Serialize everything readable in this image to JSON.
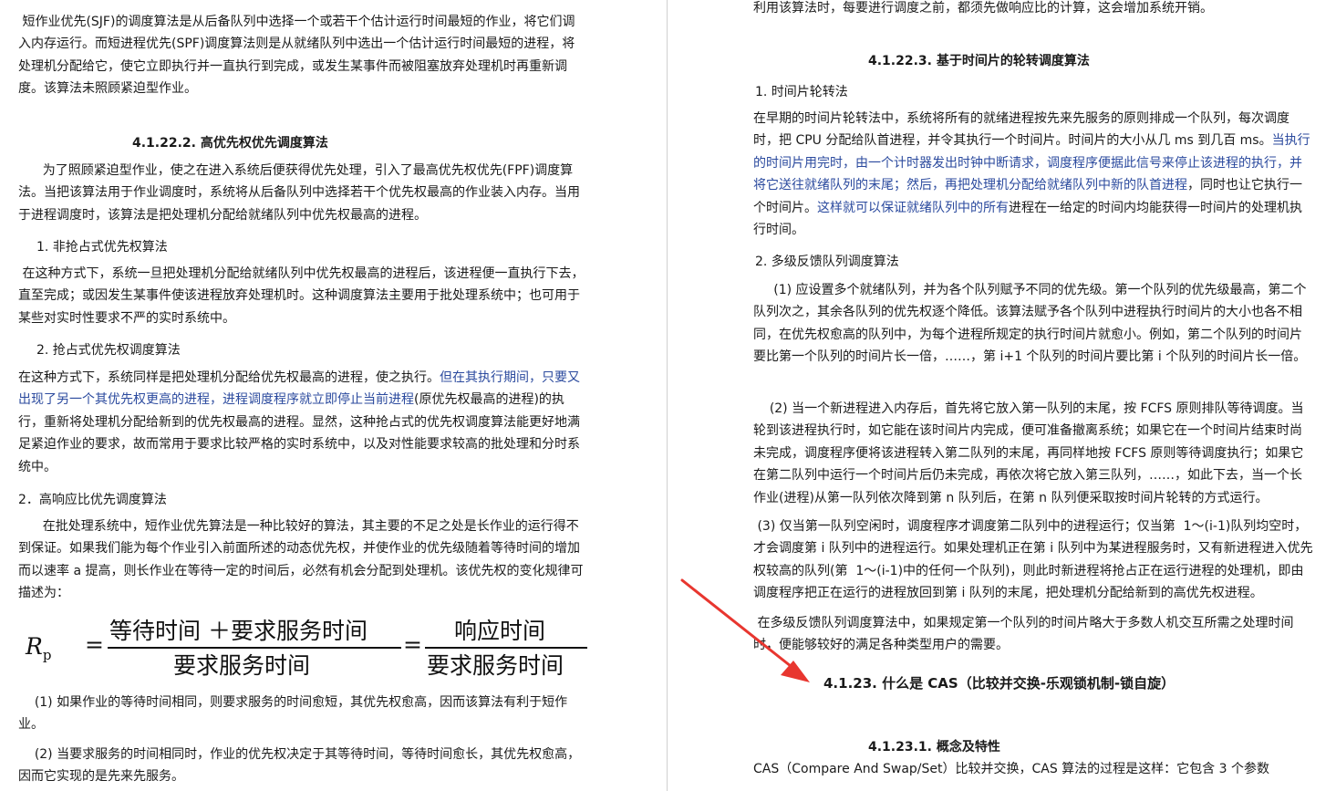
{
  "left": {
    "p1": " 短作业优先(SJF)的调度算法是从后备队列中选择一个或若干个估计运行时间最短的作业，将它们调入内存运行。而短进程优先(SPF)调度算法则是从就绪队列中选出一个估计运行时间最短的进程，将处理机分配给它，使它立即执行并一直执行到完成，或发生某事件而被阻塞放弃处理机时再重新调度。该算法未照顾紧迫型作业。",
    "h_4_1_22_2": "4.1.22.2.   高优先权优先调度算法",
    "p2": "      为了照顾紧迫型作业，使之在进入系统后便获得优先处理，引入了最高优先权优先(FPF)调度算法。当把该算法用于作业调度时，系统将从后备队列中选择若干个优先权最高的作业装入内存。当用于进程调度时，该算法是把处理机分配给就绪队列中优先权最高的进程。",
    "item1": "1.   非抢占式优先权算法",
    "p3": " 在这种方式下，系统一旦把处理机分配给就绪队列中优先权最高的进程后，该进程便一直执行下去，直至完成；或因发生某事件使该进程放弃处理机时。这种调度算法主要用于批处理系统中；也可用于某些对实时性要求不严的实时系统中。",
    "item2": "2.   抢占式优先权调度算法",
    "p4a": "在这种方式下，系统同样是把处理机分配给优先权最高的进程，使之执行。",
    "p4b": "但在其执行期间，只要又出现了另一个其优先权更高的进程，进程调度程序就立即停止当前进程",
    "p4c": "(原优先权最高的进程)的执行，重新将处理机分配给新到的优先权最高的进程。显然，这种抢占式的优先权调度算法能更好地满足紧迫作业的要求，故而常用于要求比较严格的实时系统中，以及对性能要求较高的批处理和分时系统中。",
    "item3": "2．高响应比优先调度算法",
    "p5": "      在批处理系统中，短作业优先算法是一种比较好的算法，其主要的不足之处是长作业的运行得不到保证。如果我们能为每个作业引入前面所述的动态优先权，并使作业的优先级随着等待时间的增加而以速率 a 提高，则长作业在等待一定的时间后，必然有机会分配到处理机。该优先权的变化规律可描述为：",
    "formula": {
      "lhs": "R",
      "lhs_sub": "p",
      "eq": "=",
      "num1": "等待时间 ＋要求服务时间",
      "den1": "要求服务时间",
      "num2": "响应时间",
      "den2": "要求服务时间"
    },
    "p6": "    (1) 如果作业的等待时间相同，则要求服务的时间愈短，其优先权愈高，因而该算法有利于短作业。",
    "p7": "    (2) 当要求服务的时间相同时，作业的优先权决定于其等待时间，等待时间愈长，其优先权愈高，因而它实现的是先来先服务。"
  },
  "right": {
    "p0": "利用该算法时，每要进行调度之前，都须先做响应比的计算，这会增加系统开销。",
    "h_4_1_22_3": "4.1.22.3.   基于时间片的轮转调度算法",
    "item1": "1.   时间片轮转法",
    "p1a": "在早期的时间片轮转法中，系统将所有的就绪进程按先来先服务的原则排成一个队列，每次调度时，把 CPU 分配给队首进程，并令其执行一个时间片。时间片的大小从几 ms 到几百 ms。",
    "p1b": "当执行的时间片用完时，由一个计时器发出时钟中断请求，调度程序便据此信号来停止该进程的执行，并将它送往就绪队列的末尾；然后，再把处理机分配给就绪队列中新的队首进程",
    "p1c": "，同时也让它执行一个时间片。",
    "p1d": "这样就可以保证就绪队列中的所有",
    "p1e": "进程在一给定的时间内均能获得一时间片的处理机执行时间。",
    "item2": "2.   多级反馈队列调度算法",
    "p2": "     (1) 应设置多个就绪队列，并为各个队列赋予不同的优先级。第一个队列的优先级最高，第二个队列次之，其余各队列的优先权逐个降低。该算法赋予各个队列中进程执行时间片的大小也各不相同，在优先权愈高的队列中，为每个进程所规定的执行时间片就愈小。例如，第二个队列的时间片要比第一个队列的时间片长一倍，……，第 i+1 个队列的时间片要比第 i 个队列的时间片长一倍。",
    "p3": "    (2) 当一个新进程进入内存后，首先将它放入第一队列的末尾，按 FCFS 原则排队等待调度。当轮到该进程执行时，如它能在该时间片内完成，便可准备撤离系统；如果它在一个时间片结束时尚未完成，调度程序便将该进程转入第二队列的末尾，再同样地按 FCFS 原则等待调度执行；如果它在第二队列中运行一个时间片后仍未完成，再依次将它放入第三队列，……，如此下去，当一个长作业(进程)从第一队列依次降到第 n 队列后，在第 n 队列便采取按时间片轮转的方式运行。",
    "p4": " (3) 仅当第一队列空闲时，调度程序才调度第二队列中的进程运行；仅当第  1～(i-1)队列均空时，才会调度第 i 队列中的进程运行。如果处理机正在第 i 队列中为某进程服务时，又有新进程进入优先权较高的队列(第  1～(i-1)中的任何一个队列)，则此时新进程将抢占正在运行进程的处理机，即由调度程序把正在运行的进程放回到第 i 队列的末尾，把处理机分配给新到的高优先权进程。",
    "p5": " 在多级反馈队列调度算法中，如果规定第一个队列的时间片略大于多数人机交互所需之处理时间时，便能够较好的满足各种类型用户的需要。",
    "h_4_1_23": "4.1.23.    什么是 CAS（比较并交换-乐观锁机制-锁自旋）",
    "h_4_1_23_1": "4.1.23.1.   概念及特性",
    "p6": "CAS（Compare And Swap/Set）比较并交换，CAS 算法的过程是这样：它包含 3 个参数"
  },
  "colors": {
    "text": "#1a1a1a",
    "highlight_blue": "#2b4a9e",
    "arrow_red": "#e8362f"
  }
}
